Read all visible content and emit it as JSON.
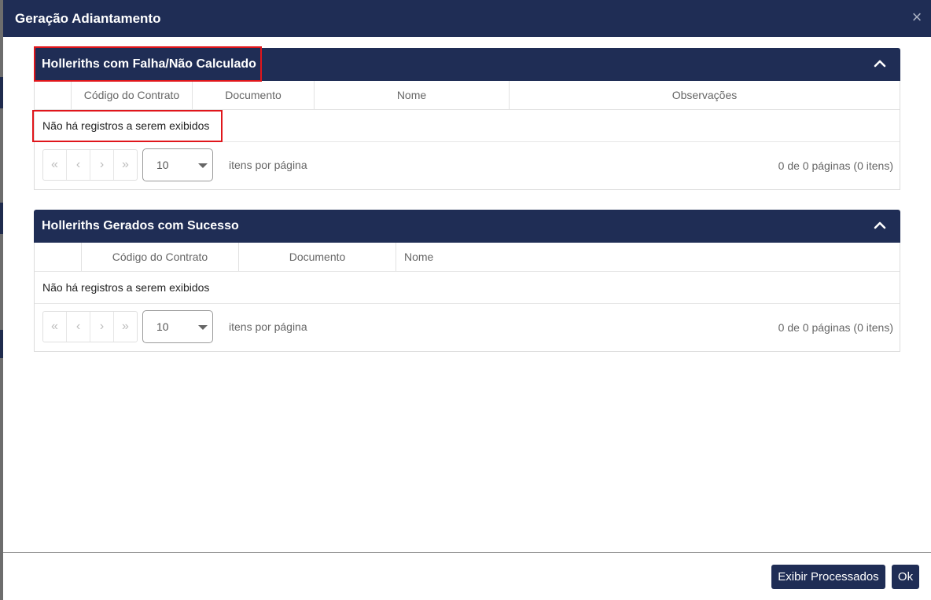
{
  "modal": {
    "title": "Geração Adiantamento",
    "close_symbol": "×"
  },
  "failed_panel": {
    "title": "Holleriths com Falha/Não Calculado",
    "columns": [
      "",
      "Código do Contrato",
      "Documento",
      "Nome",
      "Observações"
    ],
    "empty_message": "Não há registros a serem exibidos",
    "page_size": "10",
    "per_page_label": "itens por página",
    "page_info": "0 de 0 páginas (0 itens)"
  },
  "success_panel": {
    "title": "Holleriths Gerados com Sucesso",
    "columns": [
      "",
      "Código do Contrato",
      "Documento",
      "Nome"
    ],
    "empty_message": "Não há registros a serem exibidos",
    "page_size": "10",
    "per_page_label": "itens por página",
    "page_info": "0 de 0 páginas (0 itens)"
  },
  "pager_icons": {
    "first": "«",
    "prev": "‹",
    "next": "›",
    "last": "»"
  },
  "footer": {
    "show_processed_label": "Exibir Processados",
    "ok_label": "Ok"
  },
  "colors": {
    "header_bg": "#1f2d55",
    "highlight": "#e0161b"
  }
}
